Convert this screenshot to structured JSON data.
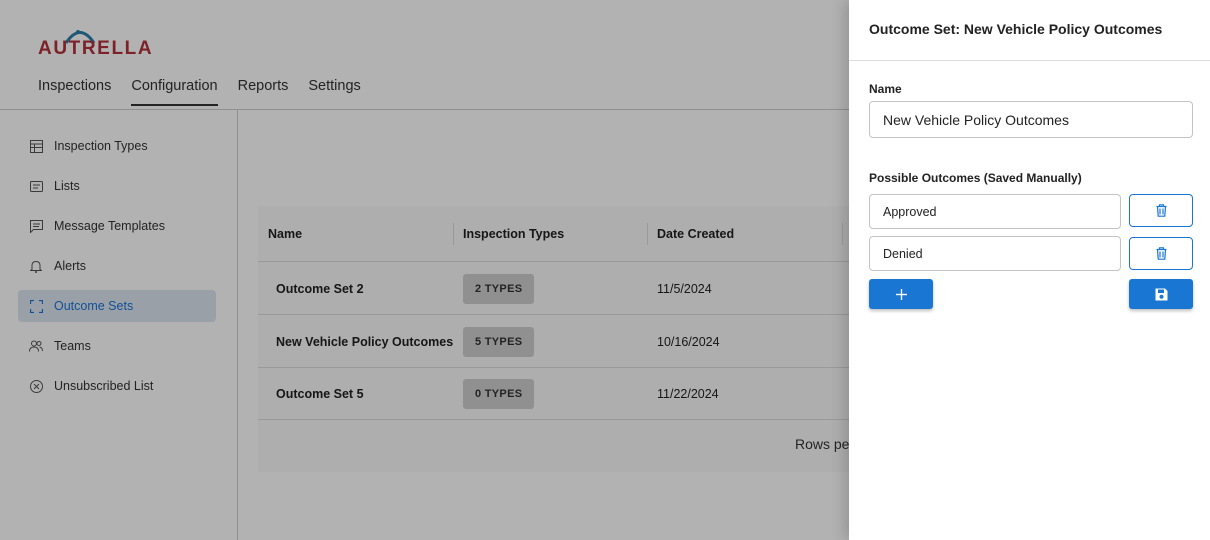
{
  "brand": {
    "logo_text": "AUTRELLA",
    "color": "#b3313a",
    "accent": "#2a7fa8"
  },
  "top_nav": [
    {
      "label": "Inspections",
      "active": false
    },
    {
      "label": "Configuration",
      "active": true
    },
    {
      "label": "Reports",
      "active": false
    },
    {
      "label": "Settings",
      "active": false
    }
  ],
  "sidebar": {
    "items": [
      {
        "label": "Inspection Types",
        "icon": "table-icon",
        "active": false
      },
      {
        "label": "Lists",
        "icon": "list-icon",
        "active": false
      },
      {
        "label": "Message Templates",
        "icon": "message-icon",
        "active": false
      },
      {
        "label": "Alerts",
        "icon": "bell-icon",
        "active": false
      },
      {
        "label": "Outcome Sets",
        "icon": "expand-icon",
        "active": true
      },
      {
        "label": "Teams",
        "icon": "people-icon",
        "active": false
      },
      {
        "label": "Unsubscribed List",
        "icon": "cancel-circle-icon",
        "active": false
      }
    ]
  },
  "table": {
    "columns": [
      "Name",
      "Inspection Types",
      "Date Created"
    ],
    "rows": [
      {
        "name": "Outcome Set 2",
        "types": "2 TYPES",
        "date": "11/5/2024"
      },
      {
        "name": "New Vehicle Policy Outcomes",
        "types": "5 TYPES",
        "date": "10/16/2024"
      },
      {
        "name": "Outcome Set 5",
        "types": "0 TYPES",
        "date": "11/22/2024"
      }
    ],
    "footer_text": "Rows pe"
  },
  "drawer": {
    "title": "Outcome Set: New Vehicle Policy Outcomes",
    "name_label": "Name",
    "name_value": "New Vehicle Policy Outcomes",
    "outcomes_label": "Possible Outcomes (Saved Manually)",
    "outcomes": [
      {
        "value": "Approved",
        "delete_icon": "trash-icon"
      },
      {
        "value": "Denied",
        "delete_icon": "trash-icon"
      }
    ],
    "add_icon": "plus-icon",
    "save_icon": "save-icon",
    "primary_color": "#1976d2"
  }
}
